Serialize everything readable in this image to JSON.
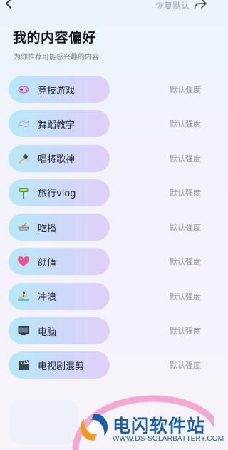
{
  "header": {
    "restore_label": "恢复默认",
    "title": "我的内容偏好",
    "subtitle": "为你推荐可能感兴趣的内容"
  },
  "preferences": [
    {
      "label": "竞技游戏",
      "strength": "默认强度",
      "icon": "game-controller-icon"
    },
    {
      "label": "舞蹈教学",
      "strength": "默认强度",
      "icon": "dance-icon"
    },
    {
      "label": "唱将歌神",
      "strength": "默认强度",
      "icon": "microphone-icon"
    },
    {
      "label": "旅行vlog",
      "strength": "默认强度",
      "icon": "signpost-icon"
    },
    {
      "label": "吃播",
      "strength": "默认强度",
      "icon": "food-bowl-icon"
    },
    {
      "label": "颜值",
      "strength": "默认强度",
      "icon": "heart-icon"
    },
    {
      "label": "冲浪",
      "strength": "默认强度",
      "icon": "surfing-icon"
    },
    {
      "label": "电脑",
      "strength": "默认强度",
      "icon": "computer-icon"
    },
    {
      "label": "电视剧混剪",
      "strength": "默认强度",
      "icon": "clapperboard-icon"
    }
  ],
  "watermark": {
    "name": "电闪软件站",
    "url": "WWW.DS-SOLARBATTERY.COM"
  },
  "colors": {
    "pill_start": "#b6e9f5",
    "pill_end": "#e2cff8",
    "brand_blue": "#1b5ea6",
    "brand_orange": "#f39a1c",
    "decor_pink": "#f19ac8"
  }
}
